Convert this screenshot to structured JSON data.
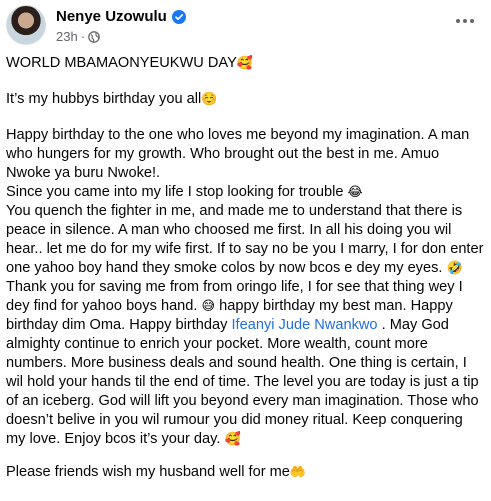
{
  "post": {
    "author": "Nenye Uzowulu",
    "timestamp": "23h",
    "dot": "·",
    "icons": {
      "verified": "verified-badge-icon",
      "audience": "globe-icon",
      "more": "more-options-icon"
    },
    "title_line": "WORLD MBAMAONYEUKWU DAY",
    "title_emoji": "🥰",
    "line2": "It’s my hubbys birthday you all",
    "line2_emoji": "☺️",
    "p1": "Happy birthday to the one who loves me beyond my imagination. A man who hungers for my growth. Who brought out the best in me. Amuo Nwoke ya buru Nwoke!.",
    "p2": "Since you came into my life I stop looking for trouble",
    "p2_emoji": "😂",
    "p3": "You quench the fighter in me, and made me to understand that there is peace in silence. A man who choosed me first. In all his doing you wil hear.. let me do for my wife first. If to say no be you I marry, I for don enter one yahoo boy hand they smoke colos by now bcos e dey my eyes.",
    "p3_emoji": "🤣",
    "p4_a": "Thank you for saving me from from oringo life, I for see that thing wey I dey find for yahoo boys hand.",
    "p4_emoji": "😅",
    "p4_b": "happy birthday my best man. Happy birthday dim Oma. Happy birthday",
    "p4_link": "Ifeanyi Jude Nwankwo",
    "p4_c": ". May God almighty continue to enrich your pocket. More wealth, count more numbers. More business deals and sound health. One thing is certain, I wil hold your hands til the end of time. The level you are today is just a tip of an iceberg. God will lift you beyond every man imagination. Those who doesn’t belive in you wil rumour you did money ritual. Keep conquering my love. Enjoy bcos it’s your day.",
    "p4_end_emoji": "🥰",
    "p5": "Please friends wish my husband well for me",
    "p5_emoji": "🤲"
  },
  "colors": {
    "text": "#050505",
    "meta": "#65676b",
    "link": "#216fdb",
    "verified": "#1877f2"
  }
}
